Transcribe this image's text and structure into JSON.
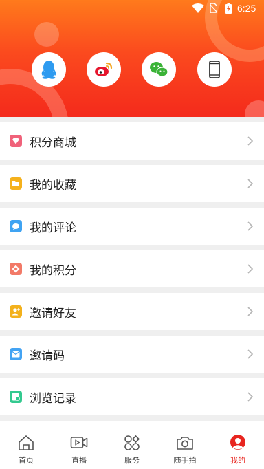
{
  "status_bar": {
    "time": "6:25"
  },
  "login_options": [
    {
      "icon": "qq-icon"
    },
    {
      "icon": "weibo-icon"
    },
    {
      "icon": "wechat-icon"
    },
    {
      "icon": "phone-icon"
    }
  ],
  "menu": {
    "items": [
      {
        "label": "积分商城",
        "icon": "gem-icon",
        "color": "#f0627a"
      },
      {
        "label": "我的收藏",
        "icon": "folder-icon",
        "color": "#f5b11c"
      },
      {
        "label": "我的评论",
        "icon": "comment-icon",
        "color": "#3fa3f2"
      },
      {
        "label": "我的积分",
        "icon": "points-icon",
        "color": "#f27a68"
      },
      {
        "label": "邀请好友",
        "icon": "invite-friend-icon",
        "color": "#f3b11c"
      },
      {
        "label": "邀请码",
        "icon": "invite-code-icon",
        "color": "#43a3f3"
      },
      {
        "label": "浏览记录",
        "icon": "history-icon",
        "color": "#33c98f"
      }
    ]
  },
  "tabbar": {
    "tabs": [
      {
        "label": "首页",
        "icon": "home-icon"
      },
      {
        "label": "直播",
        "icon": "live-video-icon"
      },
      {
        "label": "服务",
        "icon": "services-grid-icon"
      },
      {
        "label": "随手拍",
        "icon": "camera-icon"
      },
      {
        "label": "我的",
        "icon": "profile-icon",
        "active": true
      }
    ],
    "active_color": "#e8251f"
  }
}
